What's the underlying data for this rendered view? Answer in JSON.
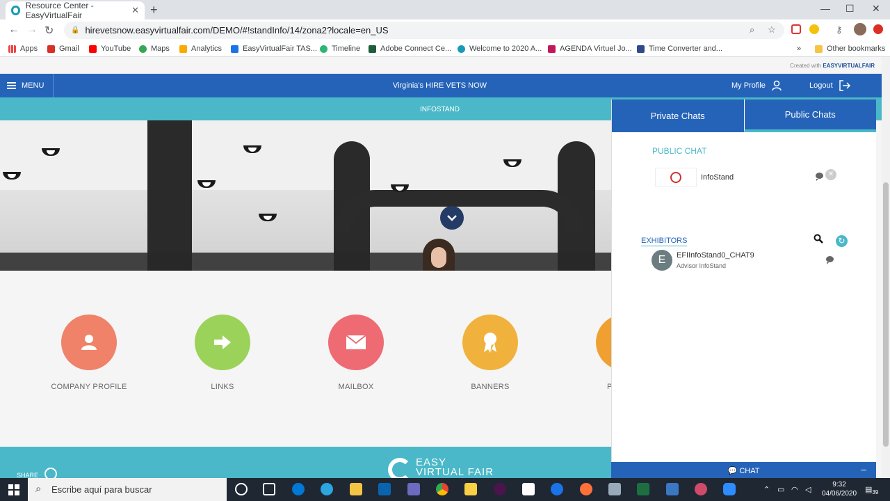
{
  "browser": {
    "tab_title": "Resource Center - EasyVirtualFair",
    "url": "hirevetsnow.easyvirtualfair.com/DEMO/#!standInfo/14/zona2?locale=en_US",
    "bookmarks": [
      "Apps",
      "Gmail",
      "YouTube",
      "Maps",
      "Analytics",
      "EasyVirtualFair TAS...",
      "Timeline",
      "Adobe Connect Ce...",
      "Welcome to 2020 A...",
      "AGENDA Virtuel Jo...",
      "Time Converter and..."
    ],
    "other_bookmarks": "Other bookmarks",
    "overflow": "»"
  },
  "site": {
    "created_with": "Created with",
    "brand": "EASYVIRTUALFAIR",
    "menu": "MENU",
    "event_title": "Virginia's HIRE VETS NOW",
    "my_profile": "My Profile",
    "logout": "Logout",
    "section": "INFOSTAND"
  },
  "features": [
    {
      "label": "COMPANY PROFILE",
      "color": "#f0826a",
      "icon": "user-icon"
    },
    {
      "label": "LINKS",
      "color": "#9bd35a",
      "icon": "arrow-icon"
    },
    {
      "label": "MAILBOX",
      "color": "#ee6b74",
      "icon": "mail-icon"
    },
    {
      "label": "BANNERS",
      "color": "#f0b23c",
      "icon": "ribbon-icon"
    }
  ],
  "partial_label": "P",
  "footer": {
    "share": "SHARE",
    "logo_line1": "EASY",
    "logo_line2": "VIRTUAL FAIR"
  },
  "chat": {
    "tab_private": "Private Chats",
    "tab_public": "Public Chats",
    "public_heading": "PUBLIC CHAT",
    "public_room": "InfoStand",
    "exhibitors_heading": "EXHIBITORS",
    "exhibitor": {
      "initial": "E",
      "name": "EFIInfoStand0_CHAT9",
      "role": "Advisor InfoStand"
    },
    "bar_label": "CHAT",
    "minimize": "–"
  },
  "taskbar": {
    "search_placeholder": "Escribe aquí para buscar",
    "time": "9:32",
    "date": "04/06/2020",
    "notif_count": "39"
  },
  "colors": {
    "primary": "#2563b8",
    "accent": "#4ab8c8"
  }
}
